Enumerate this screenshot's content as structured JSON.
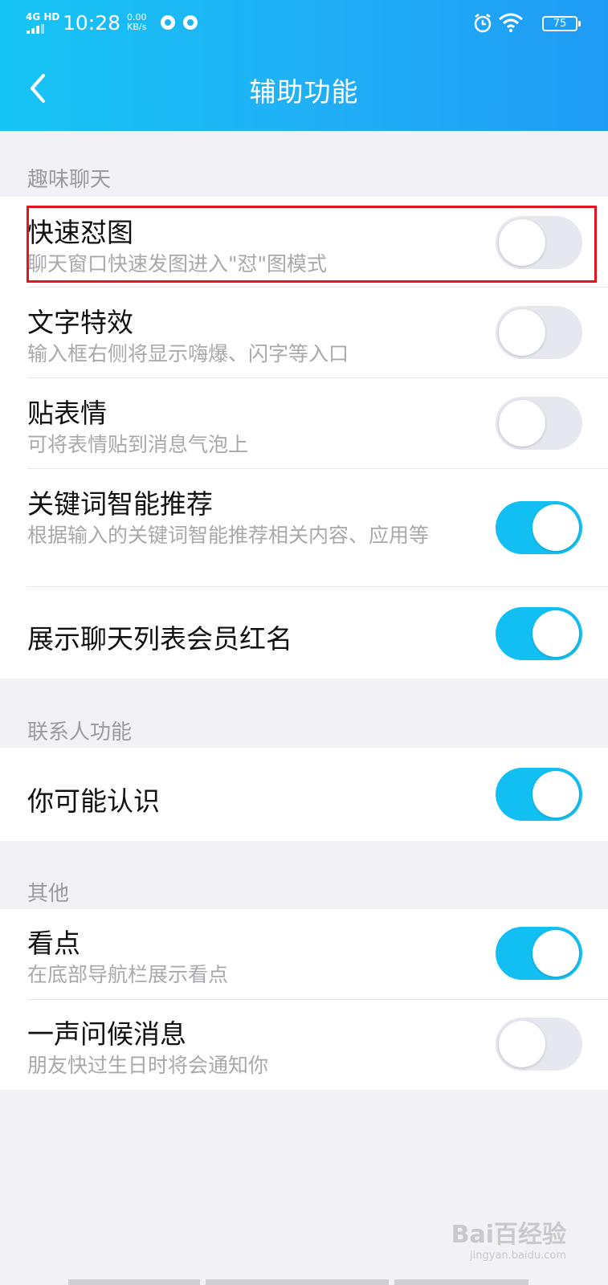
{
  "status_bar": {
    "network": "4G HD",
    "time": "10:28",
    "speed_value": "0.00",
    "speed_unit": "KB/s",
    "battery": "75"
  },
  "header": {
    "title": "辅助功能"
  },
  "sections": [
    {
      "label": "趣味聊天",
      "rows": [
        {
          "title": "快速怼图",
          "subtitle": "聊天窗口快速发图进入\"怼\"图模式",
          "enabled": false
        },
        {
          "title": "文字特效",
          "subtitle": "输入框右侧将显示嗨爆、闪字等入口",
          "enabled": false
        },
        {
          "title": "贴表情",
          "subtitle": "可将表情贴到消息气泡上",
          "enabled": false
        },
        {
          "title": "关键词智能推荐",
          "subtitle": "根据输入的关键词智能推荐相关内容、应用等",
          "enabled": true
        },
        {
          "title": "展示聊天列表会员红名",
          "enabled": true
        }
      ]
    },
    {
      "label": "联系人功能",
      "rows": [
        {
          "title": "你可能认识",
          "enabled": true
        }
      ]
    },
    {
      "label": "其他",
      "rows": [
        {
          "title": "看点",
          "subtitle": "在底部导航栏展示看点",
          "enabled": true
        },
        {
          "title": "一声问候消息",
          "subtitle": "朋友快过生日时将会通知你",
          "enabled": false
        }
      ]
    }
  ],
  "watermark": {
    "brand": "Bai百经验",
    "url": "jingyan.baidu.com"
  }
}
